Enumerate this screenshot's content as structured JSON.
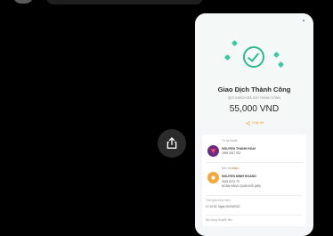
{
  "background": "#000000",
  "accent": "#2fb890",
  "link_color": "#f29b28",
  "share_icon": "share-icon",
  "receipt": {
    "title": "Giao Dịch Thành Công",
    "subtitle": "QUÝ KHÁCH ĐÃ GỬI THÀNH CÔNG",
    "amount": "55,000 VND",
    "share_label": "Chia Sẻ",
    "from_label": "Từ tài khoản",
    "from_name": "NGUYEN THANH HOAI",
    "from_account": "0398 3267 922",
    "to_label": "Đến tài khoản",
    "to_link": "Lưu",
    "to_name": "NGUYEN MINH HOANG",
    "to_account": "0325 5273 79",
    "to_bank": "NGÂN HÀNG QUÂN ĐỘI (MB)",
    "time_label": "Thời gian thực hiện",
    "time_value": "17:10:30, Ngày 06/03/2022",
    "content_label": "Nội dung chuyển tiền"
  }
}
